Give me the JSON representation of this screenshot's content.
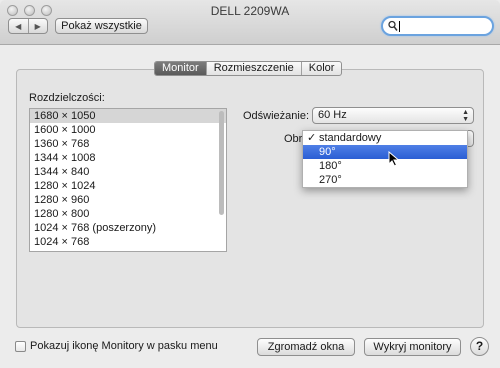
{
  "window": {
    "title": "DELL 2209WA"
  },
  "toolbar": {
    "back_label": "◀",
    "forward_label": "▶",
    "show_all_label": "Pokaż wszystkie",
    "search_value": ""
  },
  "tabs": [
    "Monitor",
    "Rozmieszczenie",
    "Kolor"
  ],
  "resolutions": {
    "label": "Rozdzielczości:",
    "items": [
      "1680 × 1050",
      "1600 × 1000",
      "1360 × 768",
      "1344 × 1008",
      "1344 × 840",
      "1280 × 1024",
      "1280 × 960",
      "1280 × 800",
      "1024 × 768 (poszerzony)",
      "1024 × 768"
    ],
    "selected_index": 0
  },
  "refresh": {
    "label": "Odświeżanie:",
    "value": "60 Hz"
  },
  "rotation": {
    "label": "Obrót",
    "options": [
      "standardowy",
      "90°",
      "180°",
      "270°"
    ],
    "checked_index": 0,
    "highlighted_index": 1
  },
  "footer": {
    "show_menu_label": "Pokazuj ikonę Monitory w pasku menu",
    "gather_label": "Zgromadź okna",
    "detect_label": "Wykryj monitory",
    "help_label": "?"
  }
}
